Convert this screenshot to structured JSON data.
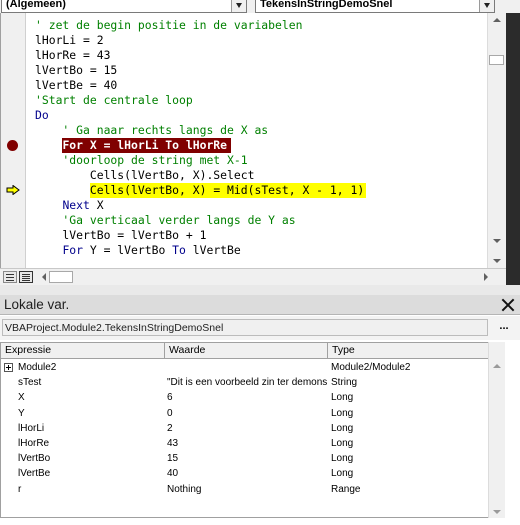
{
  "toolbar": {
    "object_combo": "(Algemeen)",
    "procedure_combo": "TekensInStringDemoSnel"
  },
  "code": {
    "lines": [
      [
        {
          "t": "' zet de begin positie in de variabelen",
          "c": "cm"
        }
      ],
      [
        {
          "t": "lHorLi = 2",
          "c": "plain"
        }
      ],
      [
        {
          "t": "lHorRe = 43",
          "c": "plain"
        }
      ],
      [
        {
          "t": "lVertBo = 15",
          "c": "plain"
        }
      ],
      [
        {
          "t": "lVertBe = 40",
          "c": "plain"
        }
      ],
      [
        {
          "t": "'Start de centrale loop",
          "c": "cm"
        }
      ],
      [
        {
          "t": "Do",
          "c": "kw"
        }
      ],
      [
        {
          "t": "    ' Ga naar rechts langs de X as",
          "c": "cm"
        }
      ],
      [
        {
          "t": "    ",
          "c": "plain"
        },
        {
          "t": "For X = lHorLi To lHorRe",
          "c": "bp"
        }
      ],
      [
        {
          "t": "    'doorloop de string met X-1",
          "c": "cm"
        }
      ],
      [
        {
          "t": "        Cells(lVertBo, X).Select",
          "c": "plain"
        }
      ],
      [
        {
          "t": "        ",
          "c": "plain"
        },
        {
          "t": "Cells(lVertBo, X) = Mid(sTest, X - 1, 1)",
          "c": "exec"
        }
      ],
      [
        {
          "t": "    ",
          "c": "plain"
        },
        {
          "t": "Next",
          "c": "kw"
        },
        {
          "t": " X",
          "c": "plain"
        }
      ],
      [
        {
          "t": "    'Ga verticaal verder langs de Y as",
          "c": "cm"
        }
      ],
      [
        {
          "t": "    lVertBo = lVertBo + 1",
          "c": "plain"
        }
      ],
      [
        {
          "t": "    ",
          "c": "plain"
        },
        {
          "t": "For",
          "c": "kw"
        },
        {
          "t": " Y = lVertBo ",
          "c": "plain"
        },
        {
          "t": "To",
          "c": "kw"
        },
        {
          "t": " lVertBe",
          "c": "plain"
        }
      ]
    ],
    "breakpoint_line": 8,
    "execution_line": 11
  },
  "locals": {
    "title": "Lokale var.",
    "context": "VBAProject.Module2.TekensInStringDemoSnel",
    "ellipsis": "...",
    "columns": [
      "Expressie",
      "Waarde",
      "Type"
    ],
    "rows": [
      {
        "expr": "Module2",
        "value": "",
        "type": "Module2/Module2",
        "expandable": true
      },
      {
        "expr": "sTest",
        "value": "\"Dit is een voorbeeld zin ter demonstratie\"",
        "type": "String",
        "expandable": false
      },
      {
        "expr": "X",
        "value": "6",
        "type": "Long",
        "expandable": false
      },
      {
        "expr": "Y",
        "value": "0",
        "type": "Long",
        "expandable": false
      },
      {
        "expr": "lHorLi",
        "value": "2",
        "type": "Long",
        "expandable": false
      },
      {
        "expr": "lHorRe",
        "value": "43",
        "type": "Long",
        "expandable": false
      },
      {
        "expr": "lVertBo",
        "value": "15",
        "type": "Long",
        "expandable": false
      },
      {
        "expr": "lVertBe",
        "value": "40",
        "type": "Long",
        "expandable": false
      },
      {
        "expr": "r",
        "value": "Nothing",
        "type": "Range",
        "expandable": false
      }
    ]
  },
  "colors": {
    "keyword": "#00008b",
    "comment": "#008000",
    "breakpoint": "#800000",
    "execution": "#ffff00"
  }
}
